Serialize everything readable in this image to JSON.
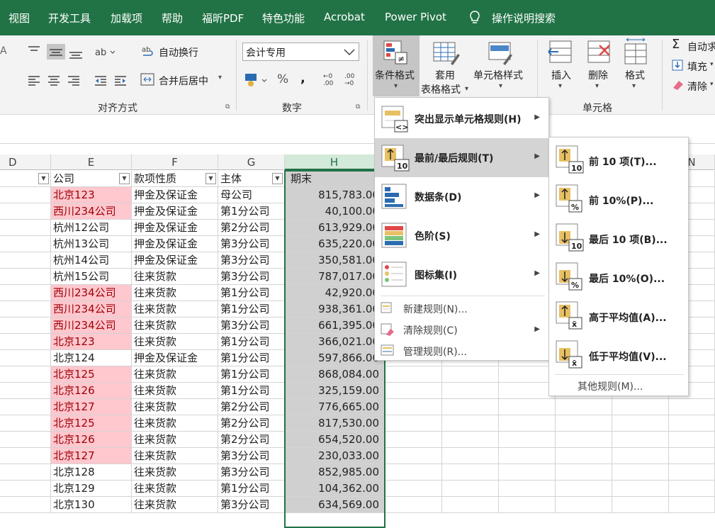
{
  "menubar": {
    "items": [
      "视图",
      "开发工具",
      "加载项",
      "帮助",
      "福昕PDF",
      "特色功能",
      "Acrobat",
      "Power Pivot",
      "操作说明搜索"
    ]
  },
  "ribbon": {
    "wrap_text": "自动换行",
    "merge_center": "合并后居中",
    "align_group": "对齐方式",
    "number_format": "会计专用",
    "number_group": "数字",
    "percent": "%",
    "comma": ",",
    "cond_format": "条件格式",
    "table_format_1": "套用",
    "table_format_2": "表格格式",
    "cell_style": "单元格样式",
    "insert": "插入",
    "delete": "删除",
    "format": "格式",
    "cells_group": "单元格",
    "autosum": "自动求",
    "fill": "填充",
    "clear": "清除"
  },
  "columns": [
    "D",
    "E",
    "F",
    "G",
    "H",
    "N"
  ],
  "headers": {
    "company": "公司",
    "nature": "款项性质",
    "entity": "主体",
    "period_end": "期末"
  },
  "rows": [
    [
      "北京123",
      "押金及保证金",
      "母公司",
      "815,783.00",
      true
    ],
    [
      "西川234公司",
      "押金及保证金",
      "第1分公司",
      "40,100.00",
      true
    ],
    [
      "杭州12公司",
      "押金及保证金",
      "第2分公司",
      "613,929.00",
      false
    ],
    [
      "杭州13公司",
      "押金及保证金",
      "第3分公司",
      "635,220.00",
      false
    ],
    [
      "杭州14公司",
      "押金及保证金",
      "第3分公司",
      "350,581.00",
      false
    ],
    [
      "杭州15公司",
      "往来货款",
      "第3分公司",
      "787,017.00",
      false
    ],
    [
      "西川234公司",
      "往来货款",
      "第1分公司",
      "42,920.00",
      true
    ],
    [
      "西川234公司",
      "往来货款",
      "第1分公司",
      "938,361.00",
      true
    ],
    [
      "西川234公司",
      "往来货款",
      "第3分公司",
      "661,395.00",
      true
    ],
    [
      "北京123",
      "往来货款",
      "第1分公司",
      "366,021.00",
      true
    ],
    [
      "北京124",
      "押金及保证金",
      "第1分公司",
      "597,866.00",
      false
    ],
    [
      "北京125",
      "往来货款",
      "第1分公司",
      "868,084.00",
      true
    ],
    [
      "北京126",
      "往来货款",
      "第1分公司",
      "325,159.00",
      true
    ],
    [
      "北京127",
      "往来货款",
      "第2分公司",
      "776,665.00",
      true
    ],
    [
      "北京125",
      "往来货款",
      "第2分公司",
      "817,530.00",
      true
    ],
    [
      "北京126",
      "往来货款",
      "第2分公司",
      "654,520.00",
      true
    ],
    [
      "北京127",
      "往来货款",
      "第3分公司",
      "230,033.00",
      true
    ],
    [
      "北京128",
      "往来货款",
      "第3分公司",
      "852,985.00",
      false
    ],
    [
      "北京129",
      "往来货款",
      "第1分公司",
      "104,362.00",
      false
    ],
    [
      "北京130",
      "往来货款",
      "第3分公司",
      "634,569.00",
      false
    ]
  ],
  "cf_menu": {
    "highlight": "突出显示单元格规则(H)",
    "topbottom": "最前/最后规则(T)",
    "databar": "数据条(D)",
    "colorscale": "色阶(S)",
    "iconset": "图标集(I)",
    "new_rule": "新建规则(N)...",
    "clear_rule": "清除规则(C)",
    "manage_rule": "管理规则(R)..."
  },
  "sub_menu": {
    "top10": "前 10 项(T)...",
    "top10pct": "前 10%(P)...",
    "bottom10": "最后 10 项(B)...",
    "bottom10pct": "最后 10%(O)...",
    "above_avg": "高于平均值(A)...",
    "below_avg": "低于平均值(V)...",
    "more": "其他规则(M)..."
  },
  "icon_labels": {
    "i10": "10",
    "pct": "%",
    "xbar": "x̄"
  }
}
